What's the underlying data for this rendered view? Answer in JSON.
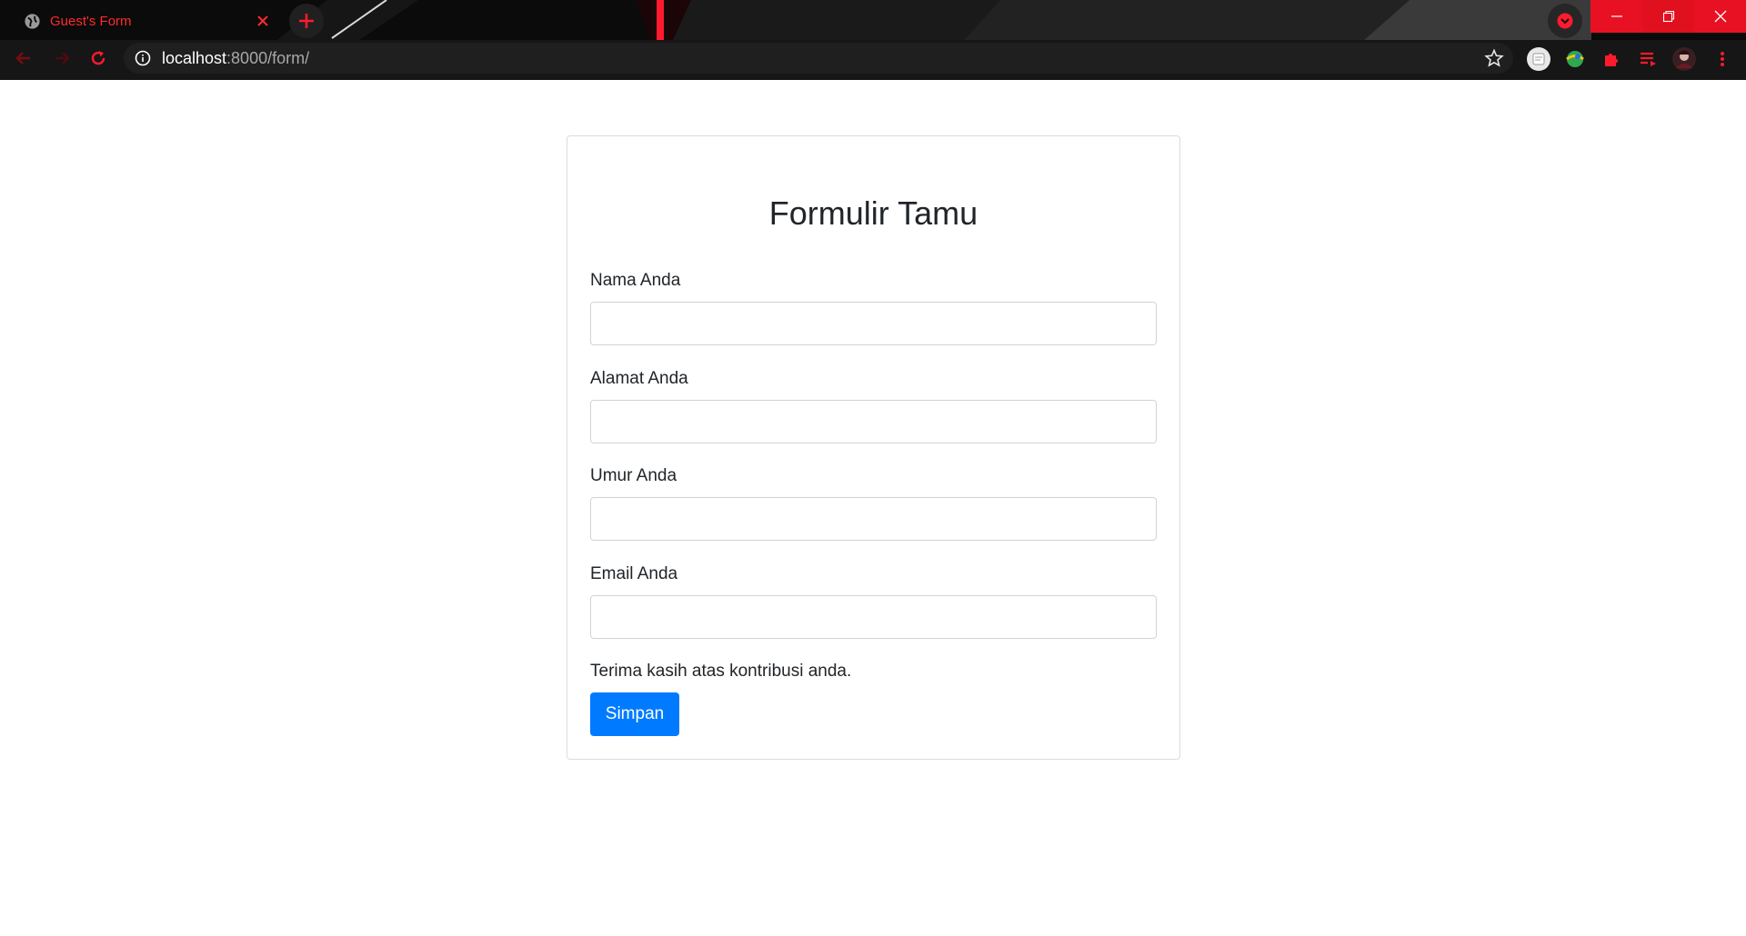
{
  "browser": {
    "tab_title": "Guest's Form",
    "url_host": "localhost",
    "url_rest": ":8000/form/",
    "accent_color": "#e81123"
  },
  "form": {
    "title": "Formulir Tamu",
    "fields": [
      {
        "label": "Nama Anda",
        "value": ""
      },
      {
        "label": "Alamat Anda",
        "value": ""
      },
      {
        "label": "Umur Anda",
        "value": ""
      },
      {
        "label": "Email Anda",
        "value": ""
      }
    ],
    "note": "Terima kasih atas kontribusi anda.",
    "submit_label": "Simpan",
    "button_color": "#007bff"
  }
}
